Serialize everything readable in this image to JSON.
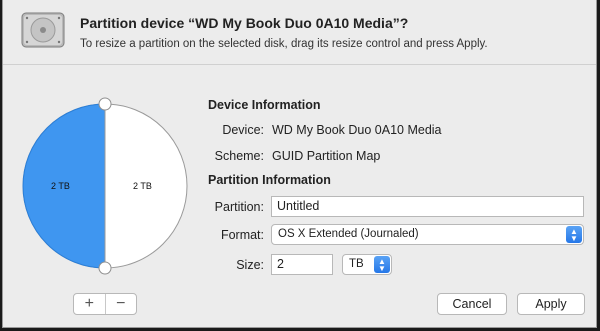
{
  "dialog": {
    "title": "Partition device “WD My Book Duo 0A10 Media”?",
    "subtitle": "To resize a partition on the selected disk, drag its resize control and press Apply."
  },
  "pie": {
    "left_label": "2 TB",
    "right_label": "2 TB",
    "left_fraction": 0.5,
    "colors": {
      "selected": "#3f96f0",
      "unselected": "#ffffff"
    }
  },
  "device_info": {
    "heading": "Device Information",
    "device_label": "Device:",
    "device_value": "WD My Book Duo 0A10 Media",
    "scheme_label": "Scheme:",
    "scheme_value": "GUID Partition Map"
  },
  "partition_info": {
    "heading": "Partition Information",
    "partition_label": "Partition:",
    "partition_value": "Untitled",
    "format_label": "Format:",
    "format_value": "OS X Extended (Journaled)",
    "size_label": "Size:",
    "size_value": "2",
    "size_unit": "TB"
  },
  "buttons": {
    "add": "+",
    "remove": "−",
    "cancel": "Cancel",
    "apply": "Apply"
  }
}
